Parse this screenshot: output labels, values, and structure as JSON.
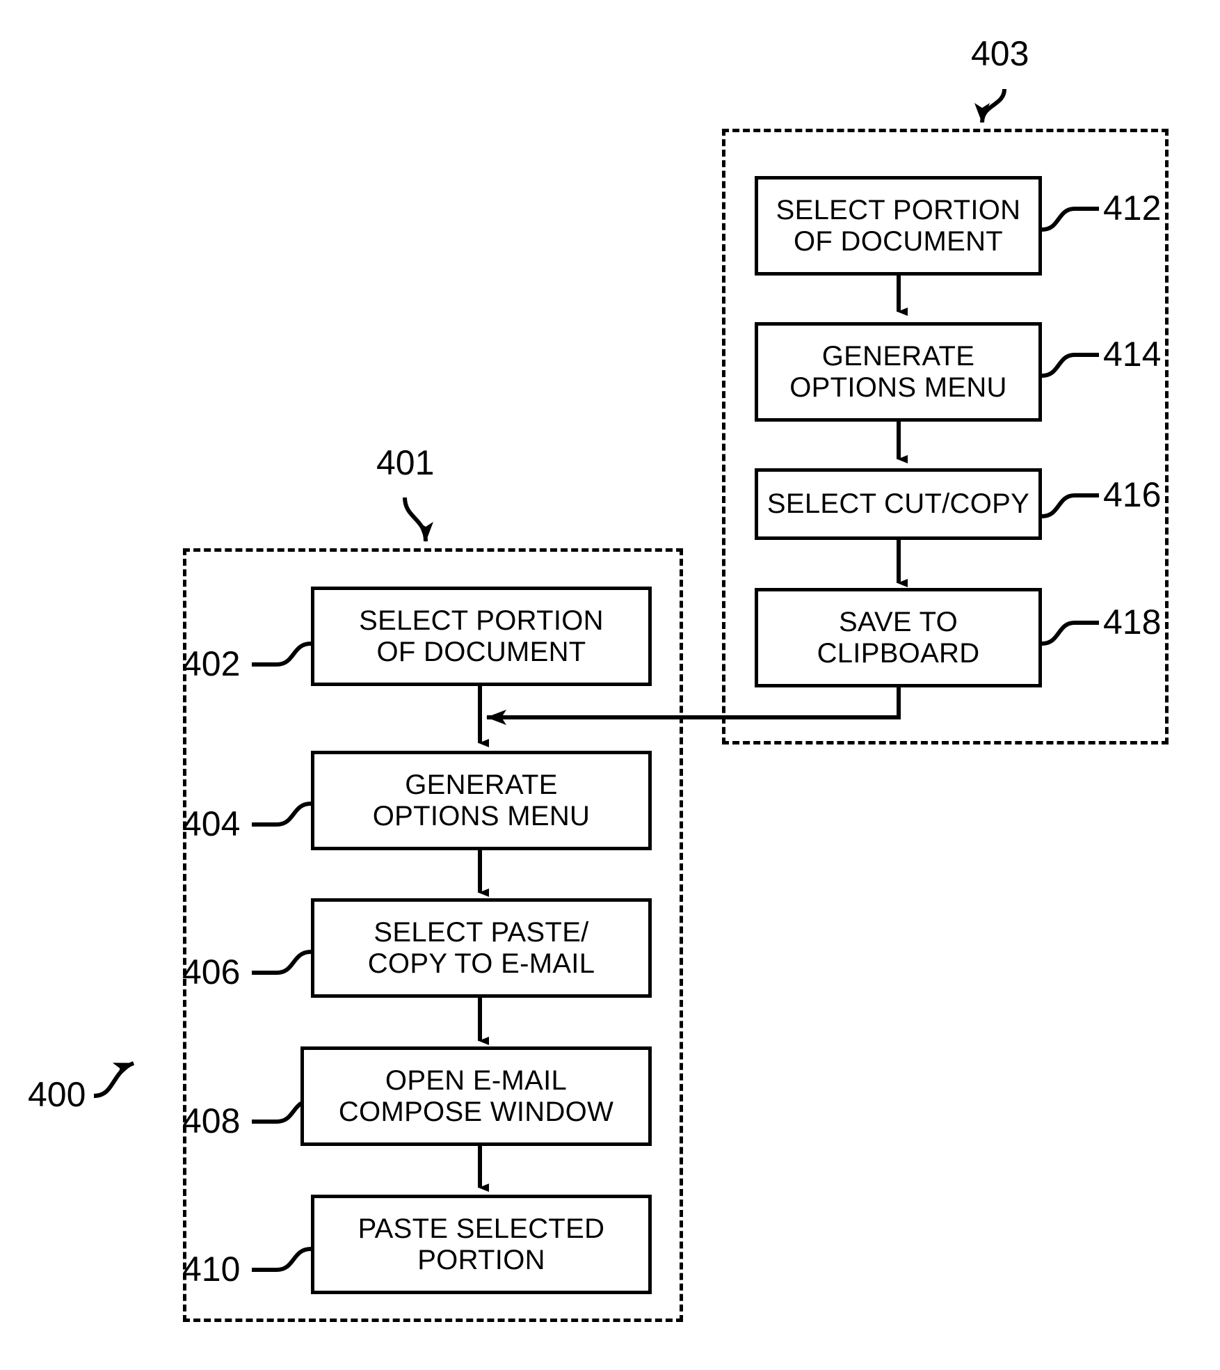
{
  "figure": {
    "overall_ref": "400",
    "groups": [
      {
        "id": "group-401",
        "ref": "401",
        "nodes": [
          {
            "ref": "402",
            "lines": [
              "SELECT PORTION",
              "OF DOCUMENT"
            ]
          },
          {
            "ref": "404",
            "lines": [
              "GENERATE",
              "OPTIONS MENU"
            ]
          },
          {
            "ref": "406",
            "lines": [
              "SELECT PASTE/",
              "COPY TO E-MAIL"
            ]
          },
          {
            "ref": "408",
            "lines": [
              "OPEN E-MAIL",
              "COMPOSE WINDOW"
            ]
          },
          {
            "ref": "410",
            "lines": [
              "PASTE SELECTED",
              "PORTION"
            ]
          }
        ]
      },
      {
        "id": "group-403",
        "ref": "403",
        "nodes": [
          {
            "ref": "412",
            "lines": [
              "SELECT PORTION",
              "OF DOCUMENT"
            ]
          },
          {
            "ref": "414",
            "lines": [
              "GENERATE",
              "OPTIONS MENU"
            ]
          },
          {
            "ref": "416",
            "lines": [
              "SELECT CUT/COPY"
            ]
          },
          {
            "ref": "418",
            "lines": [
              "SAVE TO",
              "CLIPBOARD"
            ]
          }
        ]
      }
    ],
    "colors": {
      "ink": "#000000",
      "paper": "#ffffff"
    }
  }
}
